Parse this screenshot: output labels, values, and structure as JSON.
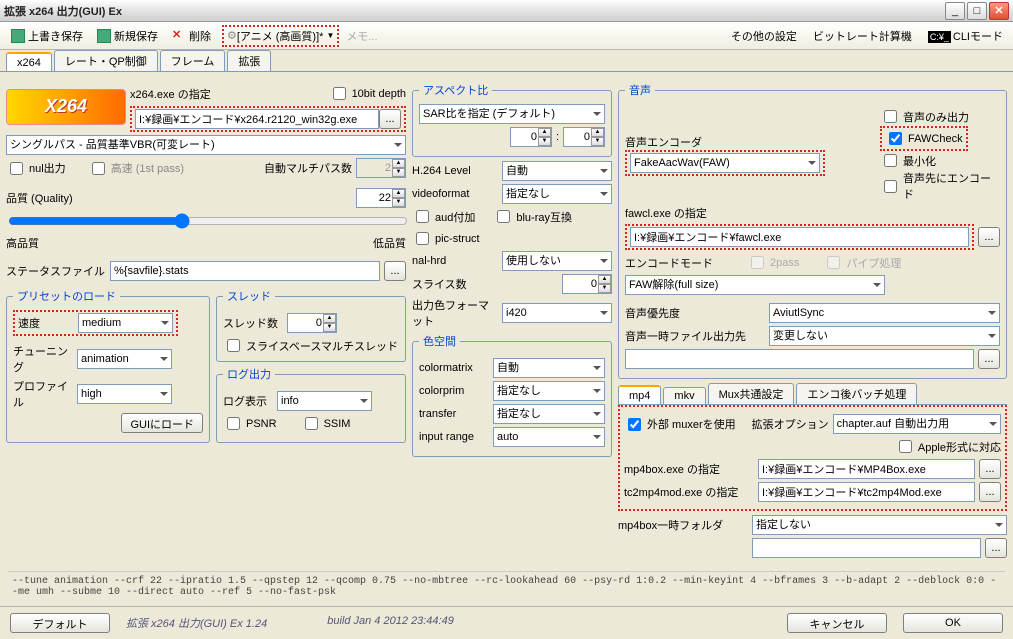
{
  "window": {
    "title": "拡張 x264 出力(GUI) Ex"
  },
  "toolbar": {
    "save_overwrite": "上書き保存",
    "save_new": "新規保存",
    "delete": "削除",
    "preset_profile": "[アニメ (高画質)]*",
    "memo": "メモ...",
    "other_settings": "その他の設定",
    "bitrate_calc": "ビットレート計算機",
    "cli_mode": "CLIモード"
  },
  "tabs": {
    "x264": "x264",
    "rate_qp": "レート・QP制御",
    "frame": "フレーム",
    "ext": "拡張"
  },
  "x264": {
    "exe_label": "x264.exe の指定",
    "tenbit": "10bit depth",
    "exe_path": "I:¥録画¥エンコード¥x264.r2120_win32g.exe",
    "mode": "シングルパス - 品質基準VBR(可変レート)",
    "nul_out": "nul出力",
    "fast_1st": "高速 (1st pass)",
    "auto_multipass": "自動マルチパス数",
    "auto_multipass_val": "2",
    "quality_label": "品質 (Quality)",
    "quality_val": "22",
    "hq": "高品質",
    "lq": "低品質",
    "statsfile_label": "ステータスファイル",
    "statsfile_val": "%{savfile}.stats"
  },
  "preset": {
    "legend": "プリセットのロード",
    "speed_label": "速度",
    "speed": "medium",
    "tune_label": "チューニング",
    "tune": "animation",
    "profile_label": "プロファイル",
    "profile": "high",
    "load_btn": "GUIにロード"
  },
  "thread": {
    "legend": "スレッド",
    "threads_label": "スレッド数",
    "threads": "0",
    "sliced": "スライスベースマルチスレッド"
  },
  "log": {
    "legend": "ログ出力",
    "level_label": "ログ表示",
    "level": "info",
    "psnr": "PSNR",
    "ssim": "SSIM"
  },
  "aspect": {
    "legend": "アスペクト比",
    "mode": "SAR比を指定 (デフォルト)",
    "w": "0",
    "h": "0"
  },
  "video": {
    "h264level_label": "H.264 Level",
    "h264level": "自動",
    "videoformat_label": "videoformat",
    "videoformat": "指定なし",
    "aud": "aud付加",
    "bluray": "blu-ray互換",
    "picstruct": "pic-struct",
    "nalhrd_label": "nal-hrd",
    "nalhrd": "使用しない",
    "slice_label": "スライス数",
    "slice": "0",
    "colorfmt_label": "出力色フォーマット",
    "colorfmt": "i420"
  },
  "color": {
    "legend": "色空間",
    "colormatrix_label": "colormatrix",
    "colormatrix": "自動",
    "colorprim_label": "colorprim",
    "colorprim": "指定なし",
    "transfer_label": "transfer",
    "transfer": "指定なし",
    "inputrange_label": "input range",
    "inputrange": "auto"
  },
  "audio": {
    "legend": "音声",
    "encoder_label": "音声エンコーダ",
    "encoder": "FakeAacWav(FAW)",
    "audio_only": "音声のみ出力",
    "fawcheck": "FAWCheck",
    "minimize": "最小化",
    "audio_first": "音声先にエンコード",
    "fawcl_label": "fawcl.exe の指定",
    "fawcl_path": "I:¥録画¥エンコード¥fawcl.exe",
    "enc_mode_label": "エンコードモード",
    "twopass": "2pass",
    "pipe": "パイプ処理",
    "enc_mode": "FAW解除(full size)",
    "priority_label": "音声優先度",
    "priority": "AviutlSync",
    "tmp_label": "音声一時ファイル出力先",
    "tmp": "変更しない",
    "tmp_path": ""
  },
  "mux": {
    "tabs": {
      "mp4": "mp4",
      "mkv": "mkv",
      "common": "Mux共通設定",
      "post": "エンコ後バッチ処理"
    },
    "use_ext": "外部 muxerを使用",
    "ext_opt_label": "拡張オプション",
    "ext_opt": "chapter.auf 自動出力用",
    "apple": "Apple形式に対応",
    "mp4box_label": "mp4box.exe の指定",
    "mp4box_path": "I:¥録画¥エンコード¥MP4Box.exe",
    "tc2mp4_label": "tc2mp4mod.exe の指定",
    "tc2mp4_path": "I:¥録画¥エンコード¥tc2mp4Mod.exe",
    "mp4tmp_label": "mp4box一時フォルダ",
    "mp4tmp": "指定しない",
    "mp4tmp_path": ""
  },
  "cmdline": "--tune animation --crf 22 --ipratio 1.5 --qpstep 12 --qcomp 0.75 --no-mbtree --rc-lookahead 60 --psy-rd 1:0.2 --min-keyint 4 --bframes 3 --b-adapt 2 --deblock 0:0 --me umh --subme 10 --direct auto --ref 5 --no-fast-psk",
  "footer": {
    "default": "デフォルト",
    "app": "拡張 x264 出力(GUI) Ex 1.24",
    "build": "build Jan  4 2012 23:44:49",
    "cancel": "キャンセル",
    "ok": "OK"
  }
}
